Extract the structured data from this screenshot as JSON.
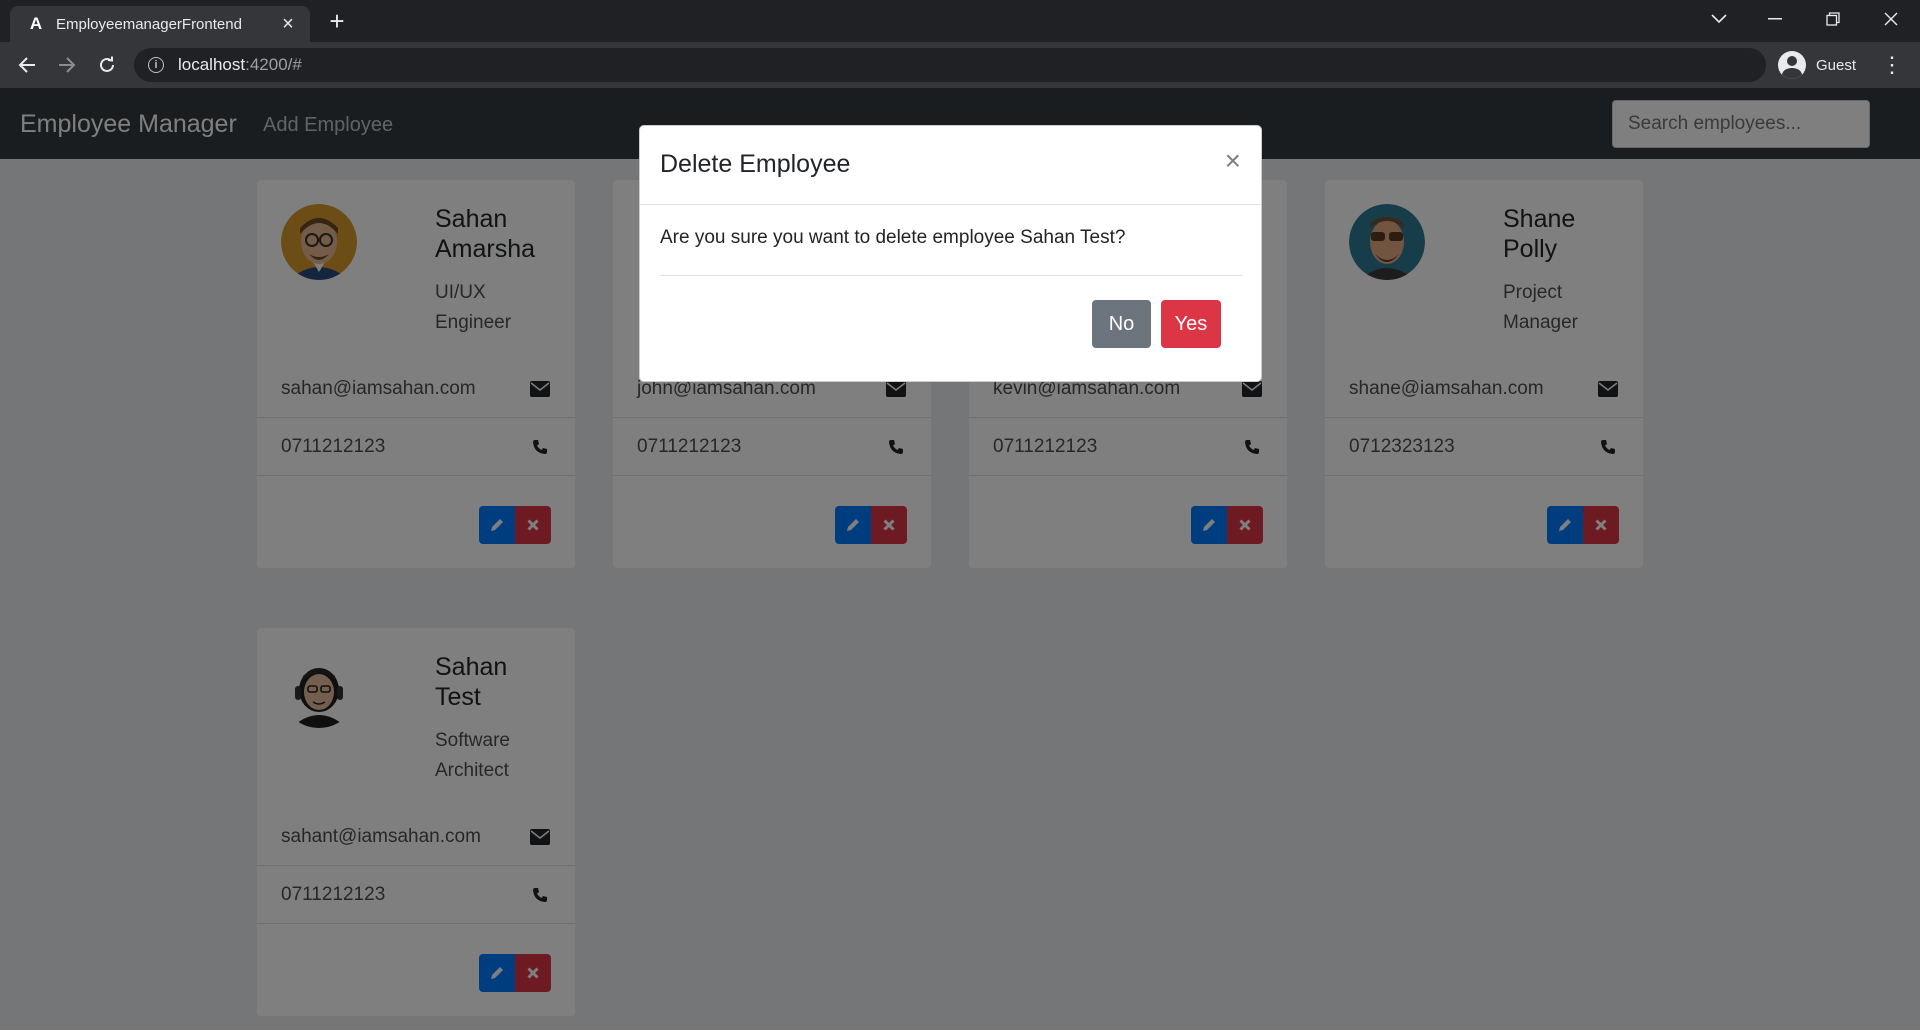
{
  "browser": {
    "tab_title": "EmployeemanagerFrontend",
    "tab_favicon": "A",
    "url_host": "localhost",
    "url_rest": ":4200/#",
    "profile_label": "Guest"
  },
  "navbar": {
    "brand": "Employee Manager",
    "add_link": "Add Employee",
    "search_placeholder": "Search employees..."
  },
  "employees": [
    {
      "name_line1": "Sahan",
      "name_line2": "Amarsha",
      "title_line1": "UI/UX",
      "title_line2": "Engineer",
      "email": "sahan@iamsahan.com",
      "phone": "0711212123",
      "avatar": "avatar-glasses-blond"
    },
    {
      "name_line1": "",
      "name_line2": "",
      "title_line1": "",
      "title_line2": "",
      "email": "john@iamsahan.com",
      "phone": "0711212123",
      "avatar": ""
    },
    {
      "name_line1": "",
      "name_line2": "",
      "title_line1": "",
      "title_line2": "",
      "email": "kevin@iamsahan.com",
      "phone": "0711212123",
      "avatar": ""
    },
    {
      "name_line1": "Shane",
      "name_line2": "Polly",
      "title_line1": "Project",
      "title_line2": "Manager",
      "email": "shane@iamsahan.com",
      "phone": "0712323123",
      "avatar": "avatar-sunglasses-beard"
    },
    {
      "name_line1": "Sahan",
      "name_line2": "Test",
      "title_line1": "Software",
      "title_line2": "Architect",
      "email": "sahant@iamsahan.com",
      "phone": "0711212123",
      "avatar": "avatar-headphones-glasses"
    }
  ],
  "modal": {
    "title": "Delete Employee",
    "close_glyph": "×",
    "message": "Are you sure you want to delete employee Sahan Test?",
    "no_label": "No",
    "yes_label": "Yes"
  },
  "colors": {
    "navbar": "#343a40",
    "primary": "#007bff",
    "danger": "#dc3545",
    "secondary": "#6c757d"
  }
}
